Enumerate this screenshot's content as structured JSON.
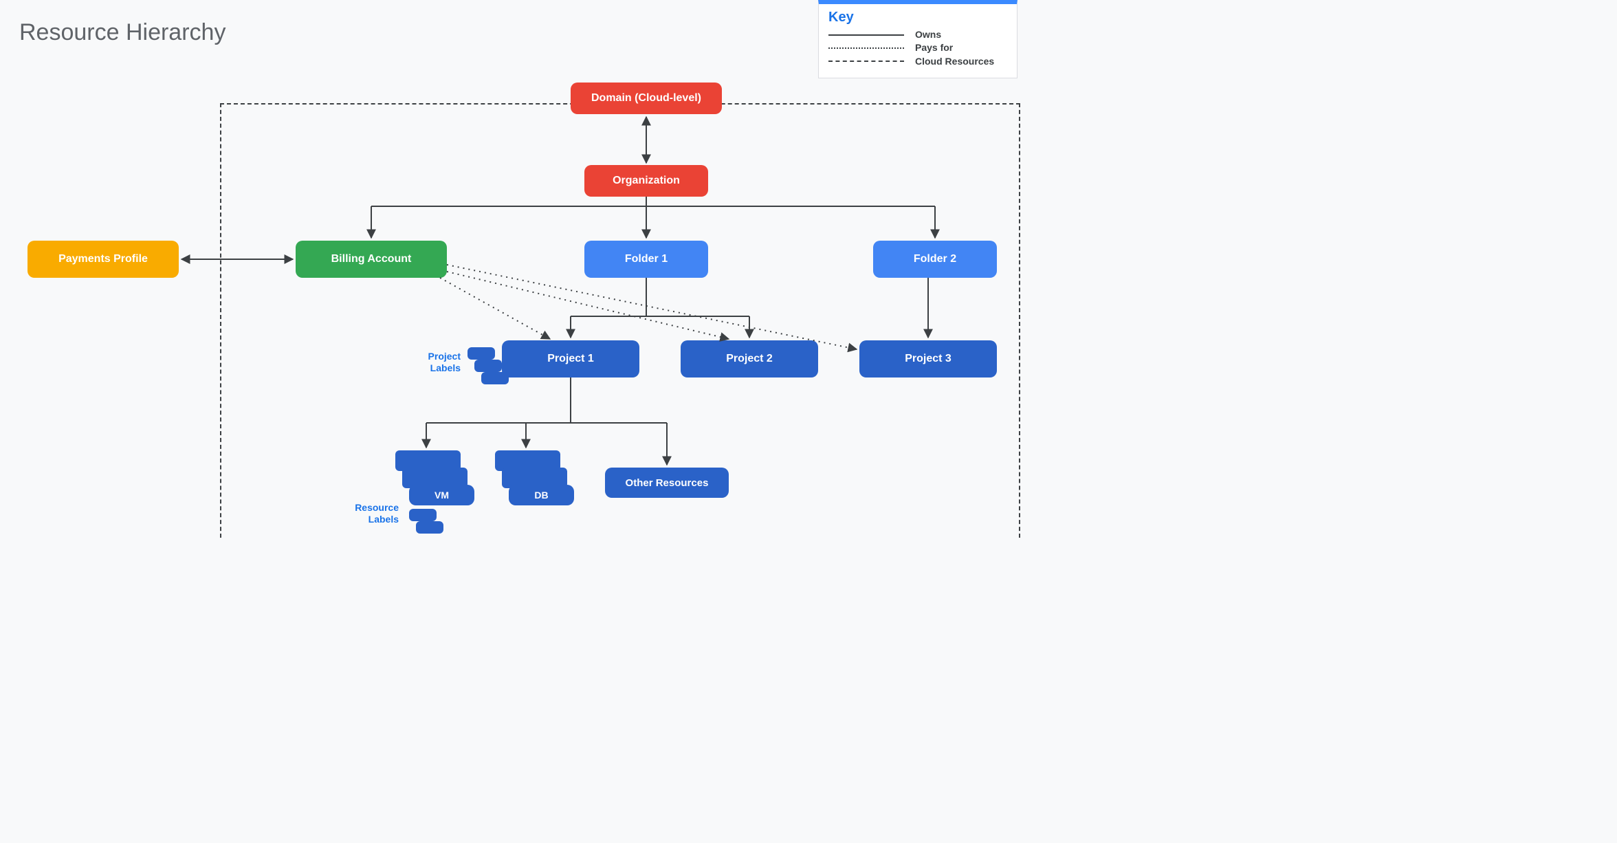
{
  "title": "Resource Hierarchy",
  "legend": {
    "title": "Key",
    "items": [
      {
        "style": "solid",
        "label": "Owns"
      },
      {
        "style": "dotted",
        "label": "Pays for"
      },
      {
        "style": "dashed",
        "label": "Cloud Resources"
      }
    ]
  },
  "nodes": {
    "domain": "Domain (Cloud-level)",
    "organization": "Organization",
    "billing_account": "Billing Account",
    "folder1": "Folder 1",
    "folder2": "Folder 2",
    "project1": "Project 1",
    "project2": "Project 2",
    "project3": "Project 3",
    "vm": "VM",
    "db": "DB",
    "other_resources": "Other Resources",
    "payments_profile": "Payments Profile"
  },
  "aux_labels": {
    "project_labels": "Project\nLabels",
    "resource_labels": "Resource\nLabels"
  }
}
